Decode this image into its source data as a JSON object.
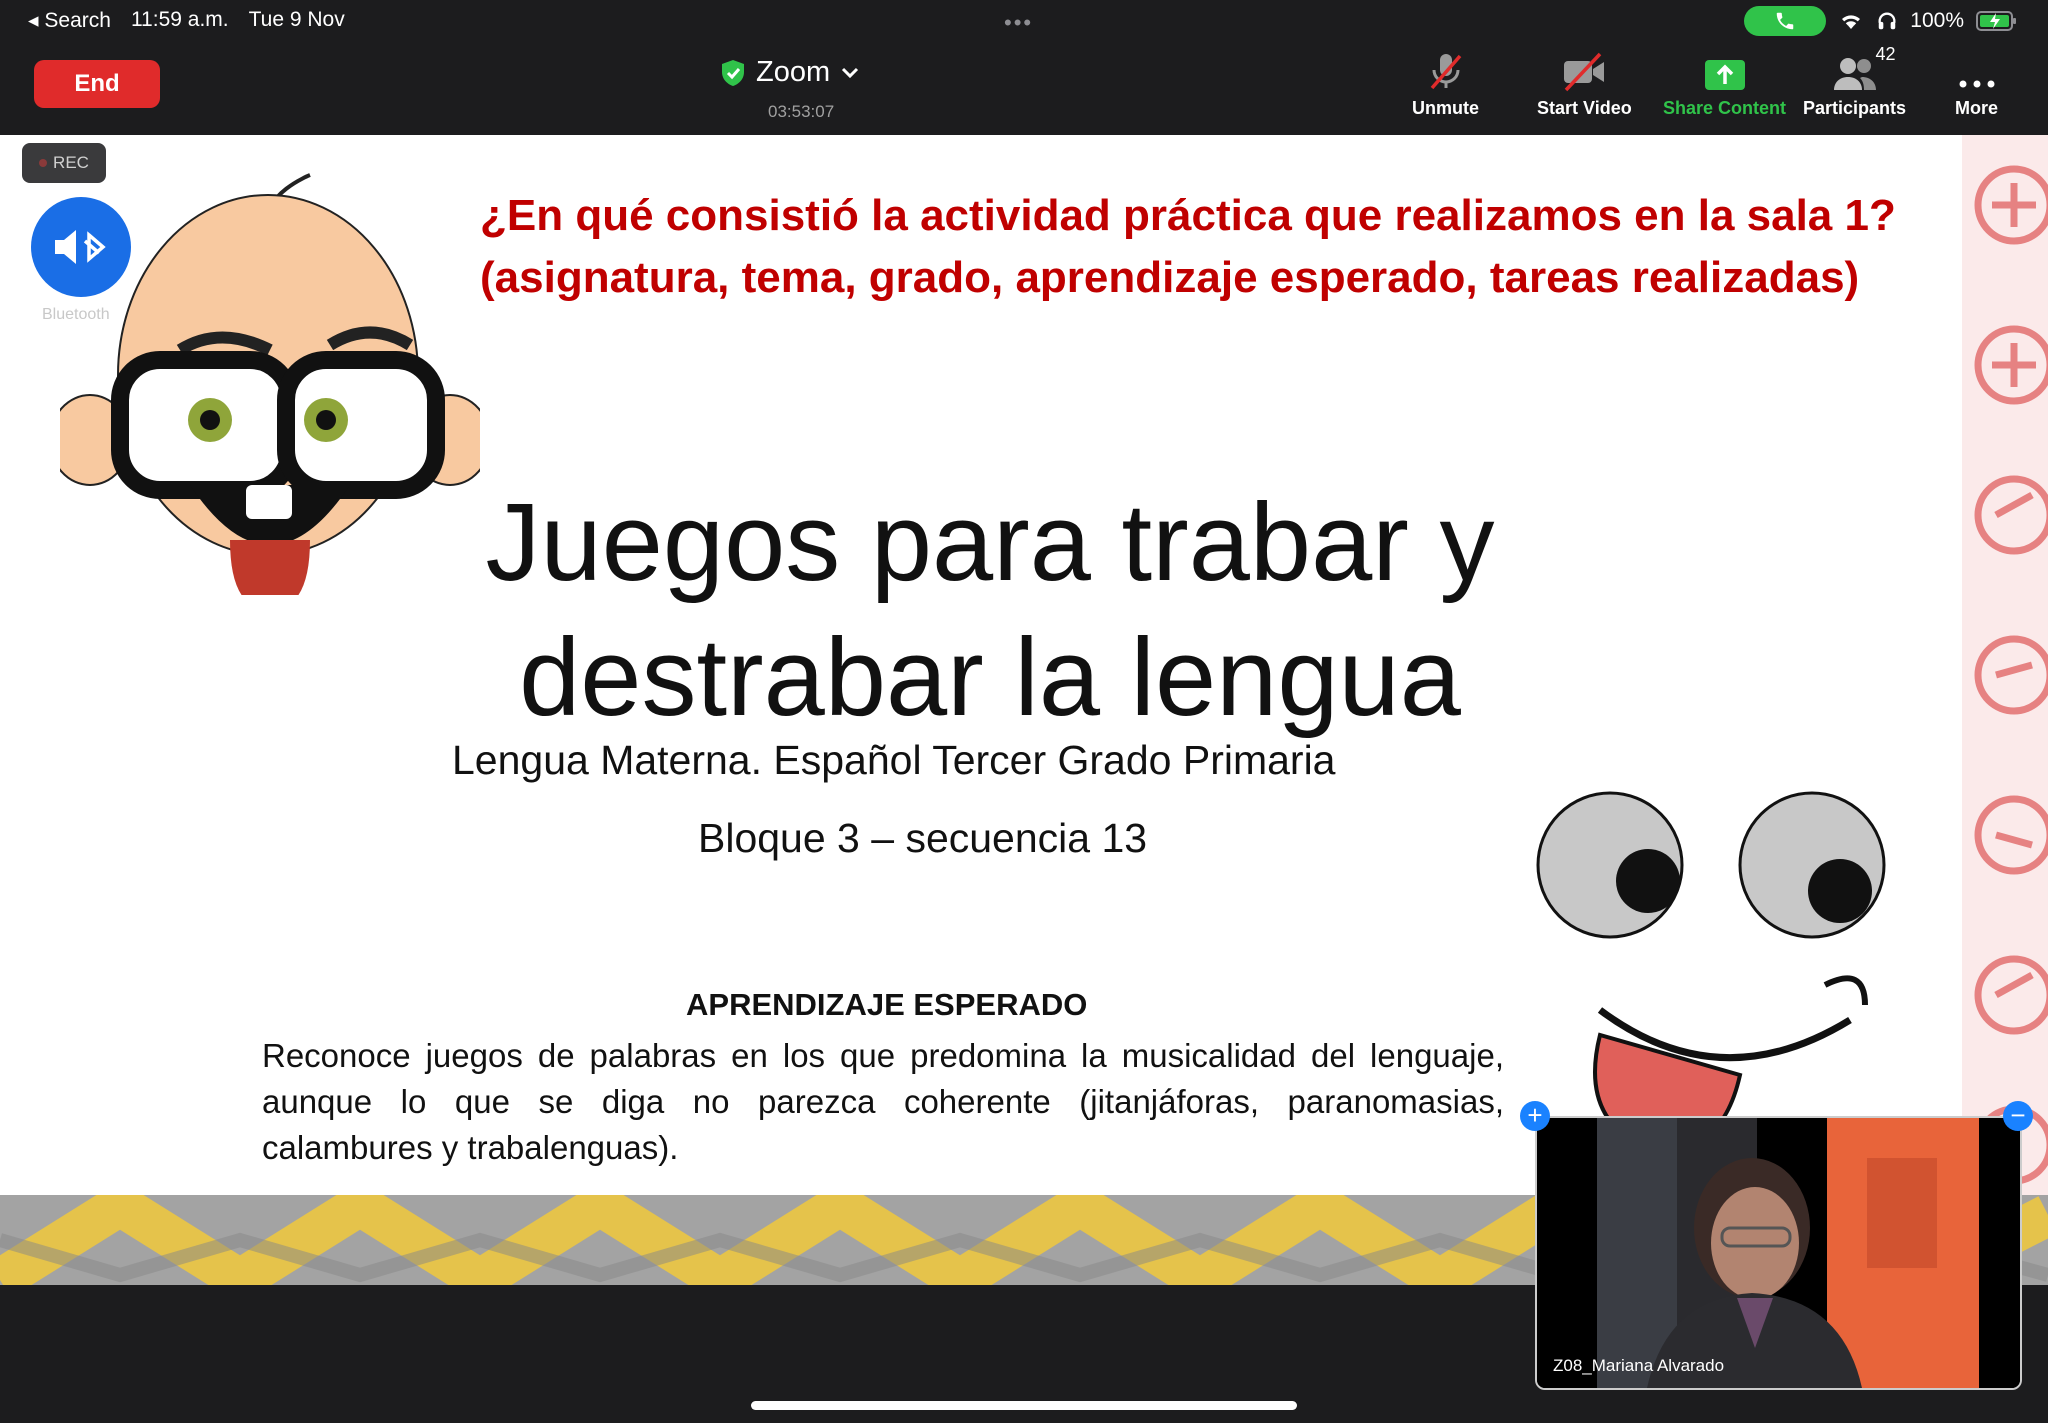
{
  "status_bar": {
    "back_label": "Search",
    "time": "11:59 a.m.",
    "date": "Tue 9 Nov",
    "battery": "100%"
  },
  "toolbar": {
    "end_label": "End",
    "meeting_title": "Zoom",
    "timer": "03:53:07",
    "unmute_label": "Unmute",
    "start_video_label": "Start Video",
    "share_label": "Share Content",
    "participants_label": "Participants",
    "participants_count": "42",
    "more_label": "More"
  },
  "overlay": {
    "rec_label": "REC",
    "bluetooth_label": "Bluetooth"
  },
  "slide": {
    "question_line1": "¿En qué consistió la actividad práctica que realizamos en la sala 1?",
    "question_line2": "(asignatura, tema, grado, aprendizaje esperado, tareas realizadas)",
    "title_line1": "Juegos para trabar y",
    "title_line2": "destrabar la lengua",
    "subtitle": "Lengua Materna. Español Tercer Grado Primaria",
    "block": "Bloque 3 – secuencia 13",
    "aprendizaje_heading": "APRENDIZAJE ESPERADO",
    "aprendizaje_text": "Reconoce juegos de palabras en los que predomina la musicalidad del lenguaje, aunque lo que se diga no parezca coherente (jitanjáforas, paranomasias, calambures y trabalenguas)."
  },
  "video_tile": {
    "participant_name": "Z08_Mariana Alvarado"
  },
  "colors": {
    "end_red": "#e02b2b",
    "share_green": "#30c34a",
    "question_red": "#c00000",
    "accent_blue": "#1a82ff"
  }
}
